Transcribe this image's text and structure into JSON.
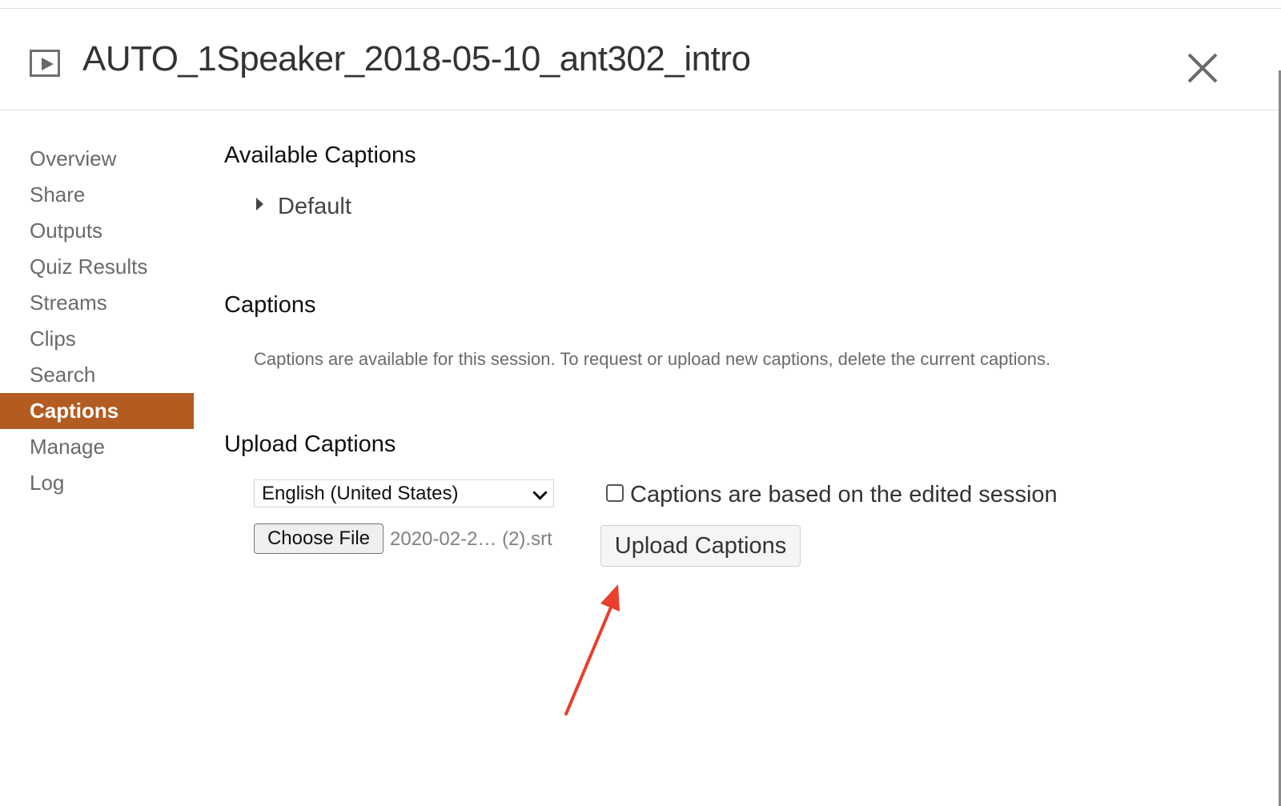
{
  "header": {
    "title": "AUTO_1Speaker_2018-05-10_ant302_intro",
    "icon": "play-icon",
    "close_icon": "close-icon"
  },
  "sidebar": {
    "items": [
      {
        "label": "Overview",
        "active": false
      },
      {
        "label": "Share",
        "active": false
      },
      {
        "label": "Outputs",
        "active": false
      },
      {
        "label": "Quiz Results",
        "active": false
      },
      {
        "label": "Streams",
        "active": false
      },
      {
        "label": "Clips",
        "active": false
      },
      {
        "label": "Search",
        "active": false
      },
      {
        "label": "Captions",
        "active": true
      },
      {
        "label": "Manage",
        "active": false
      },
      {
        "label": "Log",
        "active": false
      }
    ],
    "active_color": "#b35c22"
  },
  "main": {
    "available_captions": {
      "heading": "Available Captions",
      "items": [
        {
          "label": "Default",
          "expanded": false
        }
      ]
    },
    "captions": {
      "heading": "Captions",
      "description": "Captions are available for this session. To request or upload new captions, delete the current captions."
    },
    "upload": {
      "heading": "Upload Captions",
      "language_select": "English (United States)",
      "choose_file_label": "Choose File",
      "file_name": "2020-02-2… (2).srt",
      "checkbox_label": "Captions are based on the edited session",
      "checkbox_checked": false,
      "upload_button_label": "Upload Captions"
    }
  },
  "annotation": {
    "type": "arrow",
    "color": "#e8402a",
    "points_to": "upload-captions-button"
  }
}
